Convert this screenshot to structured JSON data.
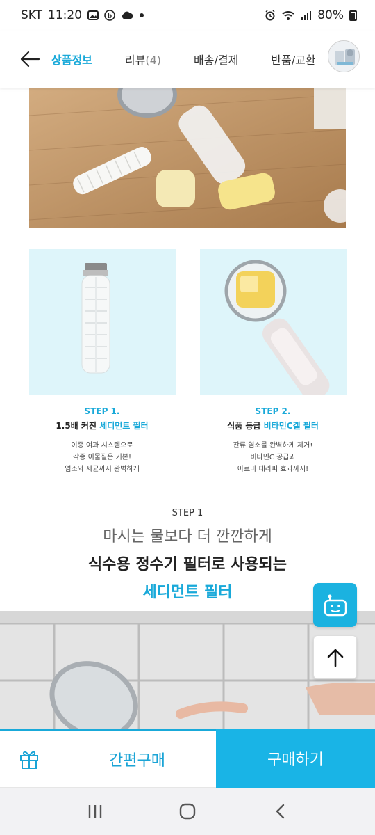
{
  "status_bar": {
    "carrier": "SKT",
    "time": "11:20",
    "battery": "80%"
  },
  "nav": {
    "tabs": [
      {
        "label": "상품정보",
        "count": ""
      },
      {
        "label": "리뷰",
        "count": "(4)"
      },
      {
        "label": "배송/결제",
        "count": ""
      },
      {
        "label": "반품/교환",
        "count": ""
      }
    ]
  },
  "steps": [
    {
      "label": "STEP 1.",
      "title_prefix": "1.5배 커진 ",
      "title_highlight": "세디먼트 필터",
      "desc": [
        "이중 여과 시스템으로",
        "각종 이물질은 기본!",
        "염소와 세균까지 완벽하게"
      ]
    },
    {
      "label": "STEP 2.",
      "title_prefix": "식품 등급 ",
      "title_highlight": "비타민C겔 필터",
      "desc": [
        "잔류 염소를 완벽하게 제거!",
        "비타민C 공급과",
        "아로마 테라피 효과까지!"
      ]
    }
  ],
  "section": {
    "step": "STEP 1",
    "line1": "마시는 물보다 더 깐깐하게",
    "line2": "식수용 정수기 필터로 사용되는",
    "line3": "세디먼트 필터"
  },
  "buy_bar": {
    "quick_buy": "간편구매",
    "buy_now": "구매하기"
  },
  "colors": {
    "accent": "#19a9d9",
    "card_bg": "#def5fa",
    "buy_now_bg": "#19b4e6"
  },
  "icons": {
    "back": "arrow-left-icon",
    "chat": "chatbot-icon",
    "top": "arrow-up-icon",
    "gift": "gift-icon"
  }
}
